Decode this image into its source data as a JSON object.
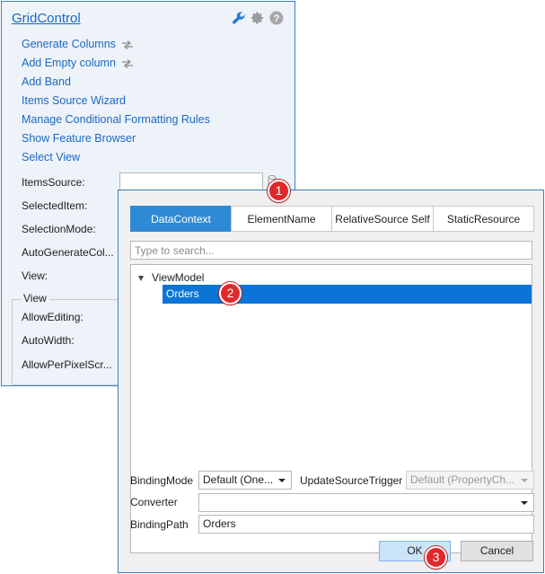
{
  "smart_panel": {
    "title": "GridControl",
    "header_icons": [
      "wrench-icon",
      "gear-icon",
      "help-icon"
    ],
    "actions": [
      {
        "label": "Generate Columns",
        "icon": "sync-icon"
      },
      {
        "label": "Add Empty column",
        "icon": "sync-icon"
      },
      {
        "label": "Add Band"
      },
      {
        "label": "Items Source Wizard"
      },
      {
        "label": "Manage Conditional Formatting Rules"
      },
      {
        "label": "Show Feature Browser"
      },
      {
        "label": "Select View"
      }
    ],
    "properties": [
      "ItemsSource:",
      "SelectedItem:",
      "SelectionMode:",
      "AutoGenerateCol...",
      "View:"
    ],
    "view_group": {
      "label": "View",
      "properties": [
        "AllowEditing:",
        "AutoWidth:",
        "AllowPerPixelScr..."
      ]
    }
  },
  "binding_editor": {
    "tabs": [
      "DataContext",
      "ElementName",
      "RelativeSource Self",
      "StaticResource"
    ],
    "active_tab": "DataContext",
    "search": {
      "placeholder": "Type to search...",
      "value": ""
    },
    "tree": {
      "root": "ViewModel",
      "children": [
        {
          "label": "Orders",
          "selected": true
        }
      ]
    },
    "binding_mode": {
      "label": "BindingMode",
      "value": "Default (One..."
    },
    "update_source_trigger": {
      "label": "UpdateSourceTrigger",
      "value": "Default (PropertyCh..."
    },
    "converter": {
      "label": "Converter",
      "value": ""
    },
    "binding_path": {
      "label": "BindingPath",
      "value": "Orders"
    },
    "ok_label": "OK",
    "cancel_label": "Cancel"
  },
  "callouts": [
    "1",
    "2",
    "3"
  ],
  "colors": {
    "accent": "#2f8ad6",
    "selection": "#0a75d6",
    "link": "#1a69c4",
    "panel_bg": "#eef2f9",
    "callout": "#e1282a"
  }
}
